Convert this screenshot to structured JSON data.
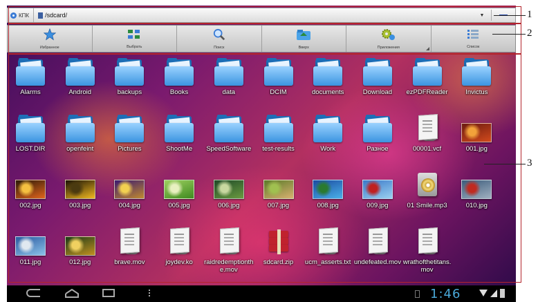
{
  "pathbar": {
    "root_label": "КПК",
    "path": "/sdcard/",
    "dropdown_icon": "triangle-down-icon",
    "minus_icon": "minus-icon"
  },
  "toolbar": {
    "items": [
      {
        "label": "Избранное",
        "icon": "star-icon"
      },
      {
        "label": "Выбрать",
        "icon": "select-grid-icon"
      },
      {
        "label": "Поиск",
        "icon": "magnifier-icon"
      },
      {
        "label": "Вверх",
        "icon": "folder-up-icon"
      },
      {
        "label": "Приложения",
        "icon": "gears-icon"
      },
      {
        "label": "Список",
        "icon": "list-icon"
      }
    ]
  },
  "files": [
    [
      {
        "name": "Alarms",
        "kind": "folder"
      },
      {
        "name": "Android",
        "kind": "folder"
      },
      {
        "name": "backups",
        "kind": "folder"
      },
      {
        "name": "Books",
        "kind": "folder"
      },
      {
        "name": "data",
        "kind": "folder"
      },
      {
        "name": "DCIM",
        "kind": "folder"
      },
      {
        "name": "documents",
        "kind": "folder"
      },
      {
        "name": "Download",
        "kind": "folder"
      },
      {
        "name": "ezPDFReader",
        "kind": "folder"
      },
      {
        "name": "Invictus",
        "kind": "folder"
      }
    ],
    [
      {
        "name": "LOST.DIR",
        "kind": "folder"
      },
      {
        "name": "openfeint",
        "kind": "folder"
      },
      {
        "name": "Pictures",
        "kind": "folder"
      },
      {
        "name": "ShootMe",
        "kind": "folder"
      },
      {
        "name": "SpeedSoftware",
        "kind": "folder"
      },
      {
        "name": "test-results",
        "kind": "folder"
      },
      {
        "name": "Work",
        "kind": "folder"
      },
      {
        "name": "Разное",
        "kind": "folder"
      },
      {
        "name": "00001.vcf",
        "kind": "doc"
      },
      {
        "name": "001.jpg",
        "kind": "image",
        "colors": [
          "#6b1a10",
          "#d24a1c",
          "#f2a23a"
        ]
      }
    ],
    [
      {
        "name": "002.jpg",
        "kind": "image",
        "colors": [
          "#2a1a08",
          "#e0641c",
          "#f5c040"
        ]
      },
      {
        "name": "003.jpg",
        "kind": "image",
        "colors": [
          "#1a1205",
          "#f0b820",
          "#4a3a10"
        ]
      },
      {
        "name": "004.jpg",
        "kind": "image",
        "colors": [
          "#3b1a70",
          "#c08a30",
          "#f2d050"
        ]
      },
      {
        "name": "005.jpg",
        "kind": "image",
        "colors": [
          "#9ed060",
          "#3f8a20",
          "#e8f0c0"
        ]
      },
      {
        "name": "006.jpg",
        "kind": "image",
        "colors": [
          "#1f4a28",
          "#6a9a40",
          "#c8d8a0"
        ]
      },
      {
        "name": "007.jpg",
        "kind": "image",
        "colors": [
          "#5a7a28",
          "#d8b070",
          "#a0c050"
        ]
      },
      {
        "name": "008.jpg",
        "kind": "image",
        "colors": [
          "#1a4aa0",
          "#4ab0e8",
          "#2a7a30"
        ]
      },
      {
        "name": "009.jpg",
        "kind": "image",
        "colors": [
          "#3a78c8",
          "#9ad0f0",
          "#c02020"
        ]
      },
      {
        "name": "01 Smile.mp3",
        "kind": "music"
      },
      {
        "name": "010.jpg",
        "kind": "image",
        "colors": [
          "#3a5a7a",
          "#a0b0c0",
          "#c02a20"
        ]
      }
    ],
    [
      {
        "name": "011.jpg",
        "kind": "image",
        "colors": [
          "#2a5aa0",
          "#8ac0e8",
          "#e0e8f0"
        ]
      },
      {
        "name": "012.jpg",
        "kind": "image",
        "colors": [
          "#1a3a18",
          "#c09020",
          "#f0d060"
        ]
      },
      {
        "name": "brave.mov",
        "kind": "doc"
      },
      {
        "name": "joydev.ko",
        "kind": "doc"
      },
      {
        "name": "raidredemptionthe.mov",
        "kind": "doc"
      },
      {
        "name": "sdcard.zip",
        "kind": "zip"
      },
      {
        "name": "ucm_asserts.txt",
        "kind": "doc"
      },
      {
        "name": "undefeated.mov",
        "kind": "doc"
      },
      {
        "name": "wrathofthetitans.mov",
        "kind": "doc"
      }
    ]
  ],
  "navbar": {
    "back_icon": "back-icon",
    "home_icon": "home-icon",
    "recent_icon": "recent-apps-icon",
    "menu_icon": "menu-dots-icon",
    "time": "1:46"
  },
  "annotations": [
    "1",
    "2",
    "3"
  ]
}
